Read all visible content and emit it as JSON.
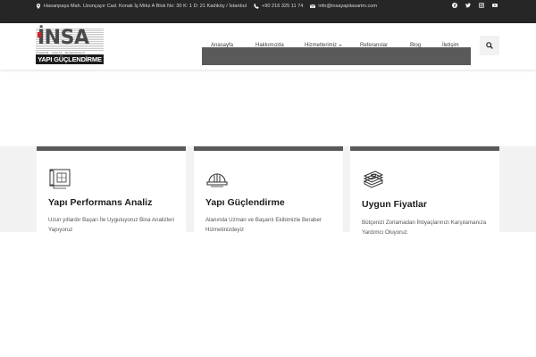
{
  "topbar": {
    "address": "Hasanpaşa Mah. Uzunçayır Cad. Konak İş Mrkz A Blok No: 30 K: 1 D: 21 Kadıköy / İstanbul",
    "phone": "+90 216 325 11 74",
    "email": "info@insayapitasarim.com",
    "social_icons": [
      "facebook-icon",
      "twitter-icon",
      "instagram-icon",
      "youtube-icon"
    ]
  },
  "logo": {
    "mark": "İNSA",
    "tagline": "TASARIM · ANALİZ · MÜHENDİSLİK",
    "name": "YAPI GÜÇLENDİRME"
  },
  "nav": {
    "items": [
      {
        "label": "Anasayfa"
      },
      {
        "label": "Hakkımızda"
      },
      {
        "label": "Hizmetlerimiz"
      },
      {
        "label": "Referanslar"
      },
      {
        "label": "Blog"
      },
      {
        "label": "İletişim"
      }
    ]
  },
  "cards": [
    {
      "icon": "blueprint-icon",
      "title": "Yapı Performans Analiz",
      "description": "Uzun yıllardır Başarı İle Uyguluyoruz Bina Analizleri Yapıyoruz"
    },
    {
      "icon": "hardhat-icon",
      "title": "Yapı Güçlendirme",
      "description": "Alanında Uzman ve Başarılı Ekibimizle Beraber Hizmetinizdeyiz"
    },
    {
      "icon": "money-stack-icon",
      "title": "Uygun Fiyatlar",
      "description": "Bütçenizi Zorlamadan İhtiyaçlarınızı Karşılamanıza Yardımcı Oluyoruz."
    }
  ],
  "colors": {
    "topbar_bg": "#262626",
    "nav_bar_bg": "#5a5a5a",
    "card_border": "#595959",
    "section_bg": "#f2f2f2",
    "logo_accent": "#d32027"
  }
}
